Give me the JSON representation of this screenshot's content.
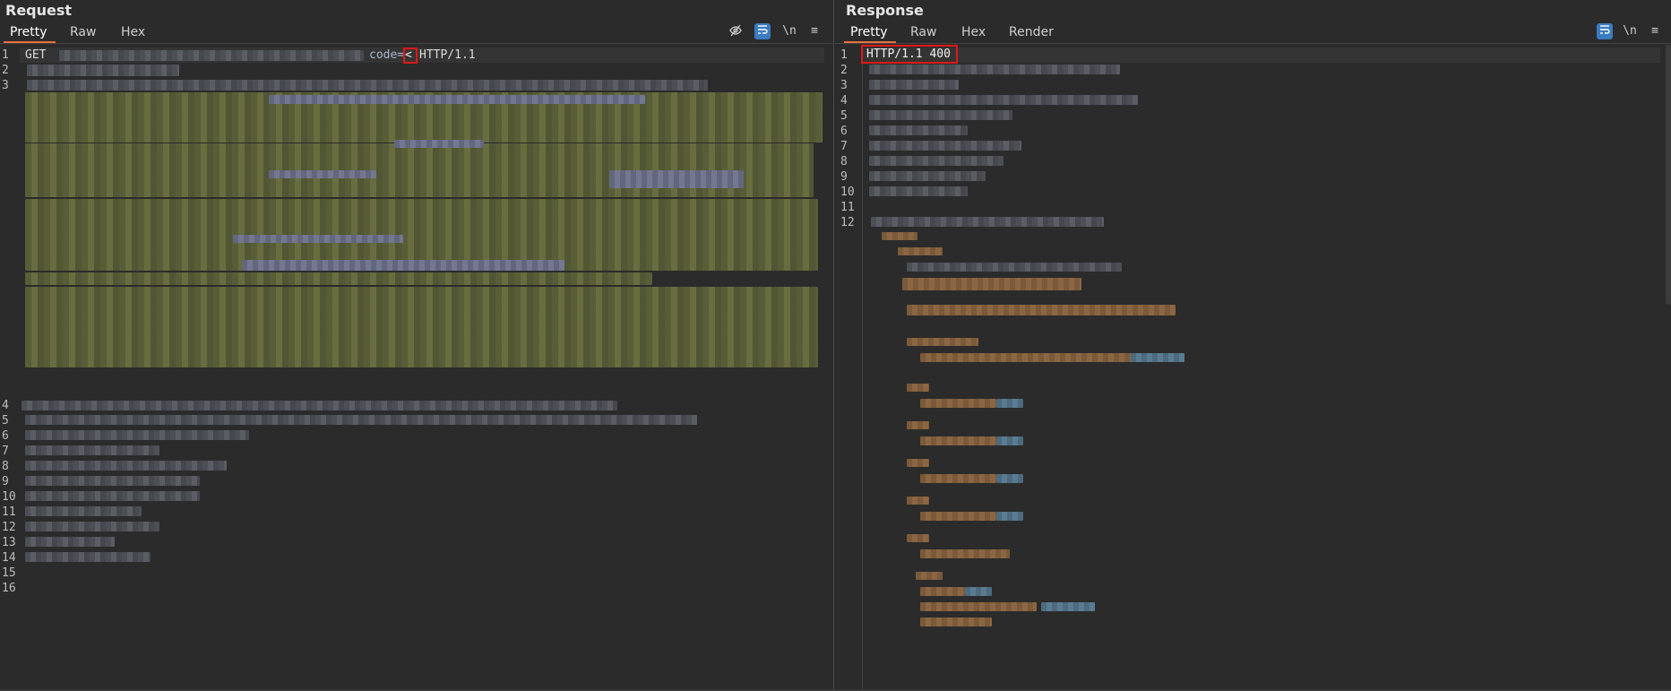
{
  "request": {
    "title": "Request",
    "tabs": [
      "Pretty",
      "Raw",
      "Hex"
    ],
    "active_tab": "Pretty",
    "icons": [
      "eye-off-icon",
      "wrap-icon",
      "newline-icon",
      "menu-icon"
    ],
    "newline_label": "\\n",
    "menu_label": "≡",
    "line_numbers": [
      "1",
      "2",
      "3",
      "4",
      "5",
      "6",
      "7",
      "8",
      "9",
      "10",
      "11",
      "12",
      "13",
      "14",
      "15",
      "16"
    ],
    "line1": {
      "method": "GET",
      "param": "code=",
      "payload": "<",
      "version": "HTTP/1.1"
    }
  },
  "response": {
    "title": "Response",
    "tabs": [
      "Pretty",
      "Raw",
      "Hex",
      "Render"
    ],
    "active_tab": "Pretty",
    "icons": [
      "wrap-icon",
      "newline-icon",
      "menu-icon"
    ],
    "newline_label": "\\n",
    "menu_label": "≡",
    "line_numbers": [
      "1",
      "2",
      "3",
      "4",
      "5",
      "6",
      "7",
      "8",
      "9",
      "10",
      "11",
      "12"
    ],
    "status_line": "HTTP/1.1 400"
  },
  "colors": {
    "accent_tab": "#e8703a",
    "highlight_box": "#e01818",
    "icon_blue": "#3b7bbf"
  }
}
